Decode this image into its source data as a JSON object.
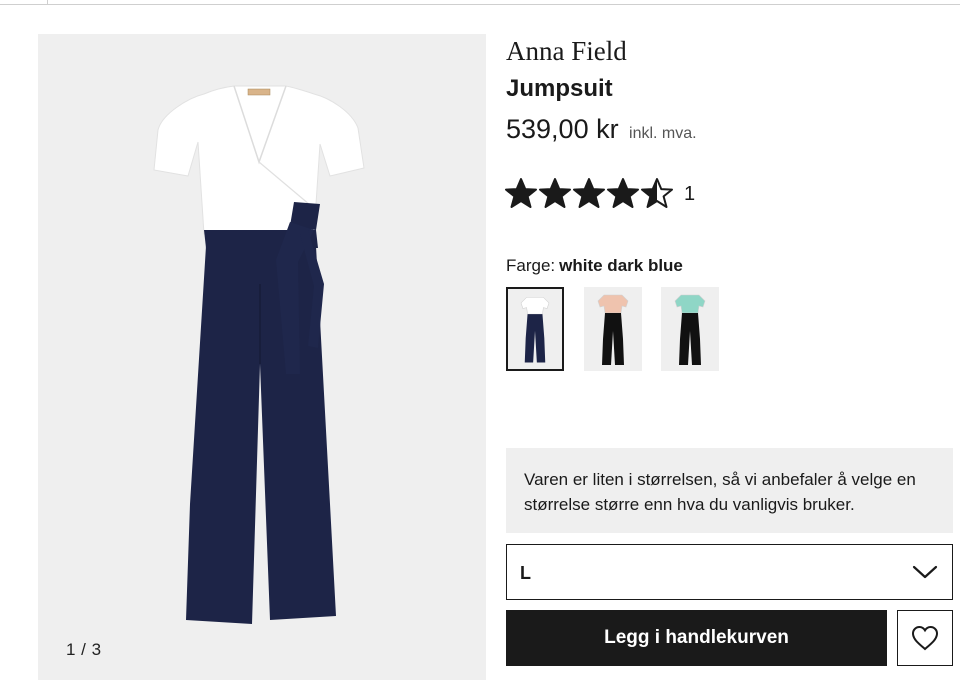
{
  "product": {
    "brand": "Anna Field",
    "name": "Jumpsuit",
    "price": "539,00 kr",
    "vat_note": "inkl. mva.",
    "rating": {
      "value": 4.5,
      "max": 5,
      "count": "1"
    }
  },
  "gallery": {
    "counter": "1 / 3"
  },
  "color": {
    "label": "Farge:",
    "value": "white dark blue",
    "swatches": [
      {
        "top": "#ffffff",
        "bottom": "#1d2447",
        "selected": true
      },
      {
        "top": "#efc3ae",
        "bottom": "#111111",
        "selected": false
      },
      {
        "top": "#8fd6c6",
        "bottom": "#111111",
        "selected": false
      }
    ]
  },
  "size_advice": "Varen er liten i størrelsen, så vi anbefaler å velge en størrelse større enn hva du vanligvis bruker.",
  "size_select": {
    "value": "L"
  },
  "cart": {
    "add_label": "Legg i handlekurven"
  },
  "icons": [
    "star-icon",
    "star-half-icon",
    "chevron-down-icon",
    "heart-icon"
  ]
}
